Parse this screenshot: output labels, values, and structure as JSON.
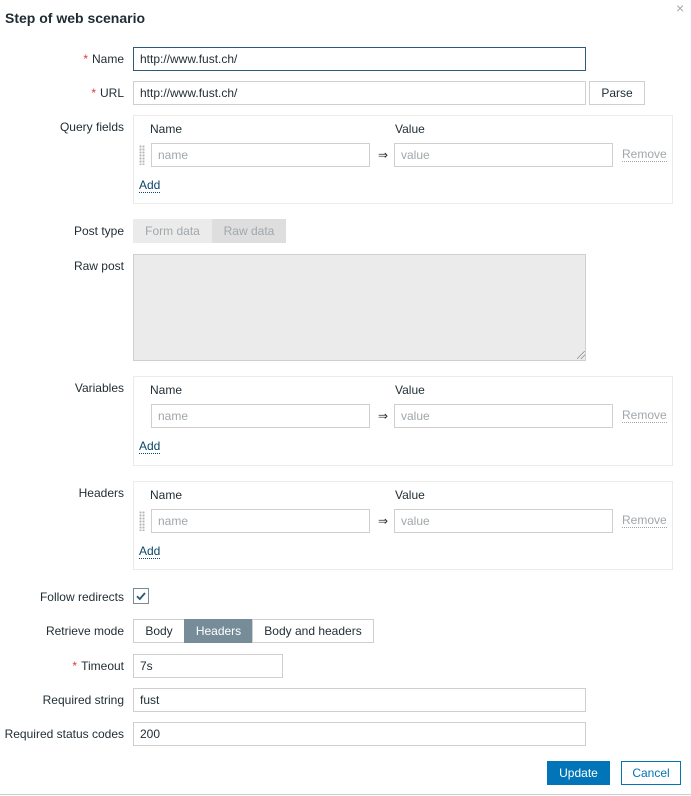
{
  "dialog": {
    "title": "Step of web scenario",
    "close_glyph": "×"
  },
  "form": {
    "name": {
      "label": "Name",
      "required": "*",
      "value": "http://www.fust.ch/"
    },
    "url": {
      "label": "URL",
      "required": "*",
      "value": "http://www.fust.ch/",
      "parse_label": "Parse"
    },
    "query_fields": {
      "label": "Query fields",
      "col_name": "Name",
      "col_value": "Value",
      "name_placeholder": "name",
      "value_placeholder": "value",
      "arrow": "⇒",
      "remove_label": "Remove",
      "add_label": "Add"
    },
    "post_type": {
      "label": "Post type",
      "options": [
        "Form data",
        "Raw data"
      ],
      "selected": "Raw data"
    },
    "raw_post": {
      "label": "Raw post",
      "value": ""
    },
    "variables": {
      "label": "Variables",
      "col_name": "Name",
      "col_value": "Value",
      "name_placeholder": "name",
      "value_placeholder": "value",
      "arrow": "⇒",
      "remove_label": "Remove",
      "add_label": "Add"
    },
    "headers": {
      "label": "Headers",
      "col_name": "Name",
      "col_value": "Value",
      "name_placeholder": "name",
      "value_placeholder": "value",
      "arrow": "⇒",
      "remove_label": "Remove",
      "add_label": "Add"
    },
    "follow_redirects": {
      "label": "Follow redirects",
      "checked": true
    },
    "retrieve_mode": {
      "label": "Retrieve mode",
      "options": [
        "Body",
        "Headers",
        "Body and headers"
      ],
      "selected": "Headers"
    },
    "timeout": {
      "label": "Timeout",
      "required": "*",
      "value": "7s"
    },
    "required_string": {
      "label": "Required string",
      "value": "fust"
    },
    "required_status_codes": {
      "label": "Required status codes",
      "value": "200"
    }
  },
  "footer": {
    "update_label": "Update",
    "cancel_label": "Cancel"
  },
  "colors": {
    "primary": "#0275b8",
    "required": "#e33734",
    "segment_active": "#768d99"
  }
}
